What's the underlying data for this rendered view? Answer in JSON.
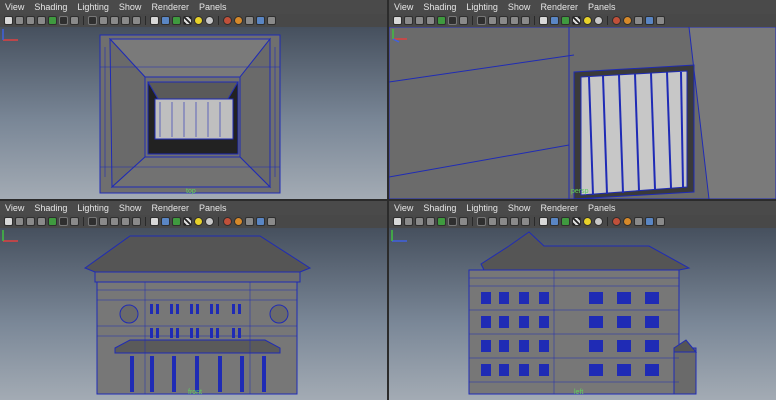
{
  "menu": [
    "View",
    "Shading",
    "Lighting",
    "Show",
    "Renderer",
    "Panels"
  ],
  "panels": [
    {
      "id": "top",
      "camera_label": "top"
    },
    {
      "id": "persp",
      "camera_label": "persp"
    },
    {
      "id": "front",
      "camera_label": "front"
    },
    {
      "id": "side",
      "camera_label": "left"
    }
  ],
  "toolbar_icons": [
    "camera-icon",
    "camera-attr-icon",
    "bookmark-icon",
    "image-plane-icon",
    "grid-icon",
    "film-gate-icon",
    "resolution-gate-icon",
    "gate-mask-icon",
    "field-chart-icon",
    "safe-action-icon",
    "safe-title-icon",
    "isolate-icon",
    "wireframe-icon",
    "smooth-shade-icon",
    "wireframe-on-shaded-icon",
    "textured-icon",
    "use-all-lights-icon",
    "shadows-icon",
    "xray-icon",
    "xray-joints-icon",
    "backface-icon",
    "resolution-icon",
    "hud-icon"
  ],
  "colors": {
    "wire": "#1f2bb5",
    "mesh": "#6f6f6f",
    "label": "#5fd05f"
  }
}
